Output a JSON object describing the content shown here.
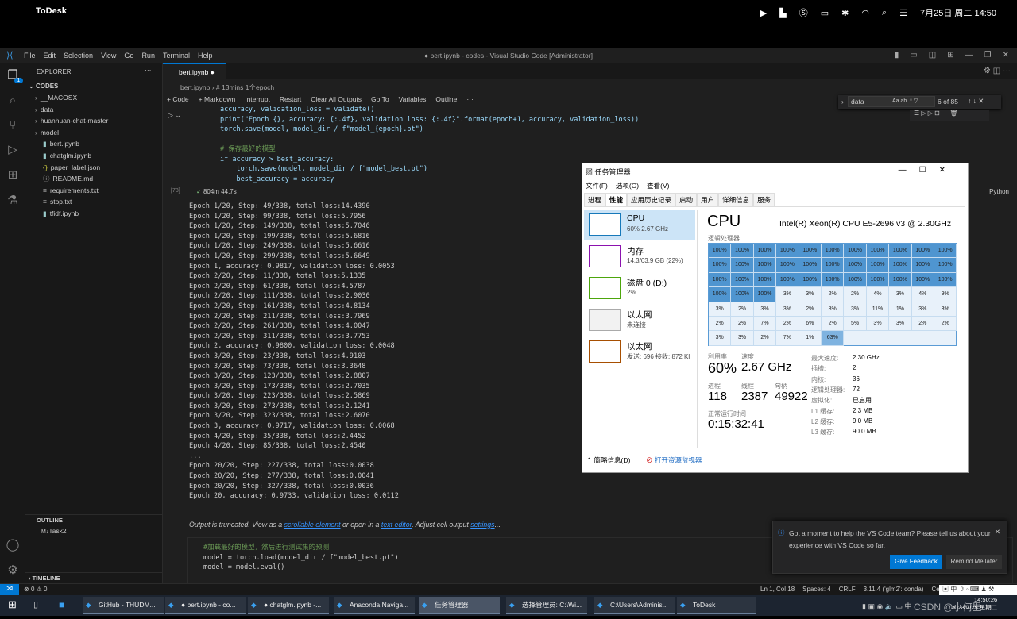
{
  "mac": {
    "app": "ToDesk",
    "datetime": "7月25日 周二  14:50"
  },
  "vscode": {
    "menu": [
      "File",
      "Edit",
      "Selection",
      "View",
      "Go",
      "Run",
      "Terminal",
      "Help"
    ],
    "title": "● bert.ipynb - codes - Visual Studio Code [Administrator]",
    "explorer_title": "EXPLORER",
    "folder": "CODES",
    "files": [
      {
        "name": "__MACOSX",
        "type": "folder"
      },
      {
        "name": "data",
        "type": "folder"
      },
      {
        "name": "huanhuan-chat-master",
        "type": "folder"
      },
      {
        "name": "model",
        "type": "folder"
      },
      {
        "name": "bert.ipynb",
        "type": "notebook"
      },
      {
        "name": "chatglm.ipynb",
        "type": "notebook"
      },
      {
        "name": "paper_label.json",
        "type": "json"
      },
      {
        "name": "README.md",
        "type": "info"
      },
      {
        "name": "requirements.txt",
        "type": "text"
      },
      {
        "name": "stop.txt",
        "type": "text"
      },
      {
        "name": "tfidf.ipynb",
        "type": "notebook"
      }
    ],
    "outline_title": "OUTLINE",
    "outline_item": "Task2",
    "timeline_title": "TIMELINE",
    "explorer_badge": "1",
    "tab": "bert.ipynb",
    "breadcrumb": [
      "bert.ipynb",
      "# 13mins 1个epoch"
    ],
    "toolbar": [
      "+ Code",
      "+ Markdown",
      "Interrupt",
      "Restart",
      "Clear All Outputs",
      "Go To",
      "Variables",
      "Outline",
      "···"
    ],
    "find": {
      "value": "data",
      "count": "6 of 85"
    },
    "code_lines": [
      "accuracy, validation_loss = validate()",
      "print(\"Epoch {}, accuracy: {:.4f}, validation loss: {:.4f}\".format(epoch+1, accuracy, validation_loss))",
      "torch.save(model, model_dir / f\"model_{epoch}.pt\")",
      "",
      "# 保存最好的模型",
      "if accuracy > best_accuracy:",
      "    torch.save(model, model_dir / f\"model_best.pt\")",
      "    best_accuracy = accuracy"
    ],
    "exec_count": "[78]",
    "exec_time": "804m 44.7s",
    "language": "Python",
    "output": [
      "Epoch 1/20, Step: 49/338, total loss:14.4390",
      "Epoch 1/20, Step: 99/338, total loss:5.7956",
      "Epoch 1/20, Step: 149/338, total loss:5.7046",
      "Epoch 1/20, Step: 199/338, total loss:5.6816",
      "Epoch 1/20, Step: 249/338, total loss:5.6616",
      "Epoch 1/20, Step: 299/338, total loss:5.6649",
      "Epoch 1, accuracy: 0.9817, validation loss: 0.0053",
      "Epoch 2/20, Step: 11/338, total loss:5.1335",
      "Epoch 2/20, Step: 61/338, total loss:4.5787",
      "Epoch 2/20, Step: 111/338, total loss:2.9030",
      "Epoch 2/20, Step: 161/338, total loss:4.8134",
      "Epoch 2/20, Step: 211/338, total loss:3.7969",
      "Epoch 2/20, Step: 261/338, total loss:4.0047",
      "Epoch 2/20, Step: 311/338, total loss:3.7753",
      "Epoch 2, accuracy: 0.9800, validation loss: 0.0048",
      "Epoch 3/20, Step: 23/338, total loss:4.9103",
      "Epoch 3/20, Step: 73/338, total loss:3.3648",
      "Epoch 3/20, Step: 123/338, total loss:2.8807",
      "Epoch 3/20, Step: 173/338, total loss:2.7035",
      "Epoch 3/20, Step: 223/338, total loss:2.5869",
      "Epoch 3/20, Step: 273/338, total loss:2.1241",
      "Epoch 3/20, Step: 323/338, total loss:2.6070",
      "Epoch 3, accuracy: 0.9717, validation loss: 0.0068",
      "Epoch 4/20, Step: 35/338, total loss:2.4452",
      "Epoch 4/20, Step: 85/338, total loss:2.4540",
      "...",
      "Epoch 20/20, Step: 227/338, total loss:0.0038",
      "Epoch 20/20, Step: 277/338, total loss:0.0041",
      "Epoch 20/20, Step: 327/338, total loss:0.0036",
      "Epoch 20, accuracy: 0.9733, validation loss: 0.0112"
    ],
    "truncated": {
      "t1": "Output is truncated. View as a ",
      "link1": "scrollable element",
      "t2": " or open in a ",
      "link2": "text editor",
      "t3": ". Adjust cell output ",
      "link3": "settings",
      "t4": "..."
    },
    "cell2_lines": [
      "#加载最好的模型，然后进行测试集的预测",
      "model = torch.load(model_dir / f\"model_best.pt\")",
      "model = model.eval()"
    ],
    "status": {
      "errors": "0",
      "warnings": "0",
      "position": "Ln 1, Col 18",
      "spaces": "Spaces: 4",
      "eol": "CRLF",
      "interpreter": "3.11.4 ('glm2': conda)",
      "cell": "Cell"
    },
    "notification": {
      "message": "Got a moment to help the VS Code team? Please tell us about your experience with VS Code so far.",
      "primary": "Give Feedback",
      "secondary": "Remind Me later"
    }
  },
  "taskmgr": {
    "title": "任务管理器",
    "menu": [
      "文件(F)",
      "选项(O)",
      "查看(V)"
    ],
    "tabs": [
      "进程",
      "性能",
      "应用历史记录",
      "启动",
      "用户",
      "详细信息",
      "服务"
    ],
    "active_tab": "性能",
    "resources": [
      {
        "name": "CPU",
        "detail": "60% 2.67 GHz",
        "color": "#1779ba"
      },
      {
        "name": "内存",
        "detail": "14.3/63.9 GB (22%)",
        "color": "#8b12ae"
      },
      {
        "name": "磁盘 0 (D:)",
        "detail": "2%",
        "color": "#4da60c"
      },
      {
        "name": "以太网",
        "detail": "未连接",
        "color": "#aaaaaa"
      },
      {
        "name": "以太网",
        "detail": "发送: 696  接收: 872 Kl",
        "color": "#a74f01"
      }
    ],
    "heading": "CPU",
    "cpu_model": "Intel(R) Xeon(R) CPU E5-2696 v3 @ 2.30GHz",
    "grid_label": "逻辑处理器",
    "cores": [
      100,
      100,
      100,
      100,
      100,
      100,
      100,
      100,
      100,
      100,
      100,
      100,
      100,
      100,
      100,
      100,
      100,
      100,
      100,
      100,
      100,
      100,
      100,
      100,
      100,
      100,
      100,
      100,
      100,
      100,
      100,
      100,
      100,
      100,
      100,
      100,
      3,
      3,
      2,
      2,
      4,
      3,
      4,
      9,
      3,
      2,
      3,
      3,
      2,
      8,
      3,
      11,
      1,
      3,
      3,
      2,
      2,
      7,
      2,
      6,
      2,
      5,
      3,
      3,
      2,
      2,
      3,
      3,
      2,
      7,
      1,
      63
    ],
    "stats": [
      {
        "label": "利用率",
        "value": "60%"
      },
      {
        "label": "速度",
        "value": "2.67 GHz"
      },
      {
        "label": "进程",
        "value": "118"
      },
      {
        "label": "线程",
        "value": "2387"
      },
      {
        "label": "句柄",
        "value": "49922"
      },
      {
        "label": "正常运行时间",
        "value": "0:15:32:41"
      }
    ],
    "specs": [
      [
        "最大速度:",
        "2.30 GHz"
      ],
      [
        "插槽:",
        "2"
      ],
      [
        "内核:",
        "36"
      ],
      [
        "逻辑处理器:",
        "72"
      ],
      [
        "虚拟化:",
        "已启用"
      ],
      [
        "L1 缓存:",
        "2.3 MB"
      ],
      [
        "L2 缓存:",
        "9.0 MB"
      ],
      [
        "L3 缓存:",
        "90.0 MB"
      ]
    ],
    "footer": {
      "less": "简略信息(D)",
      "monitor": "打开资源监视器"
    }
  },
  "taskbar": {
    "items": [
      "GitHub - THUDM...",
      "● bert.ipynb - co...",
      "● chatglm.ipynb -...",
      "Anaconda Naviga...",
      "任务管理器",
      "选择管理员: C:\\Wi...",
      "C:\\Users\\Adminis...",
      "ToDesk"
    ],
    "active": "任务管理器",
    "time": "14:50:26",
    "date": "2023/7/25 星期二",
    "watermark": "CSDN @小何里"
  }
}
